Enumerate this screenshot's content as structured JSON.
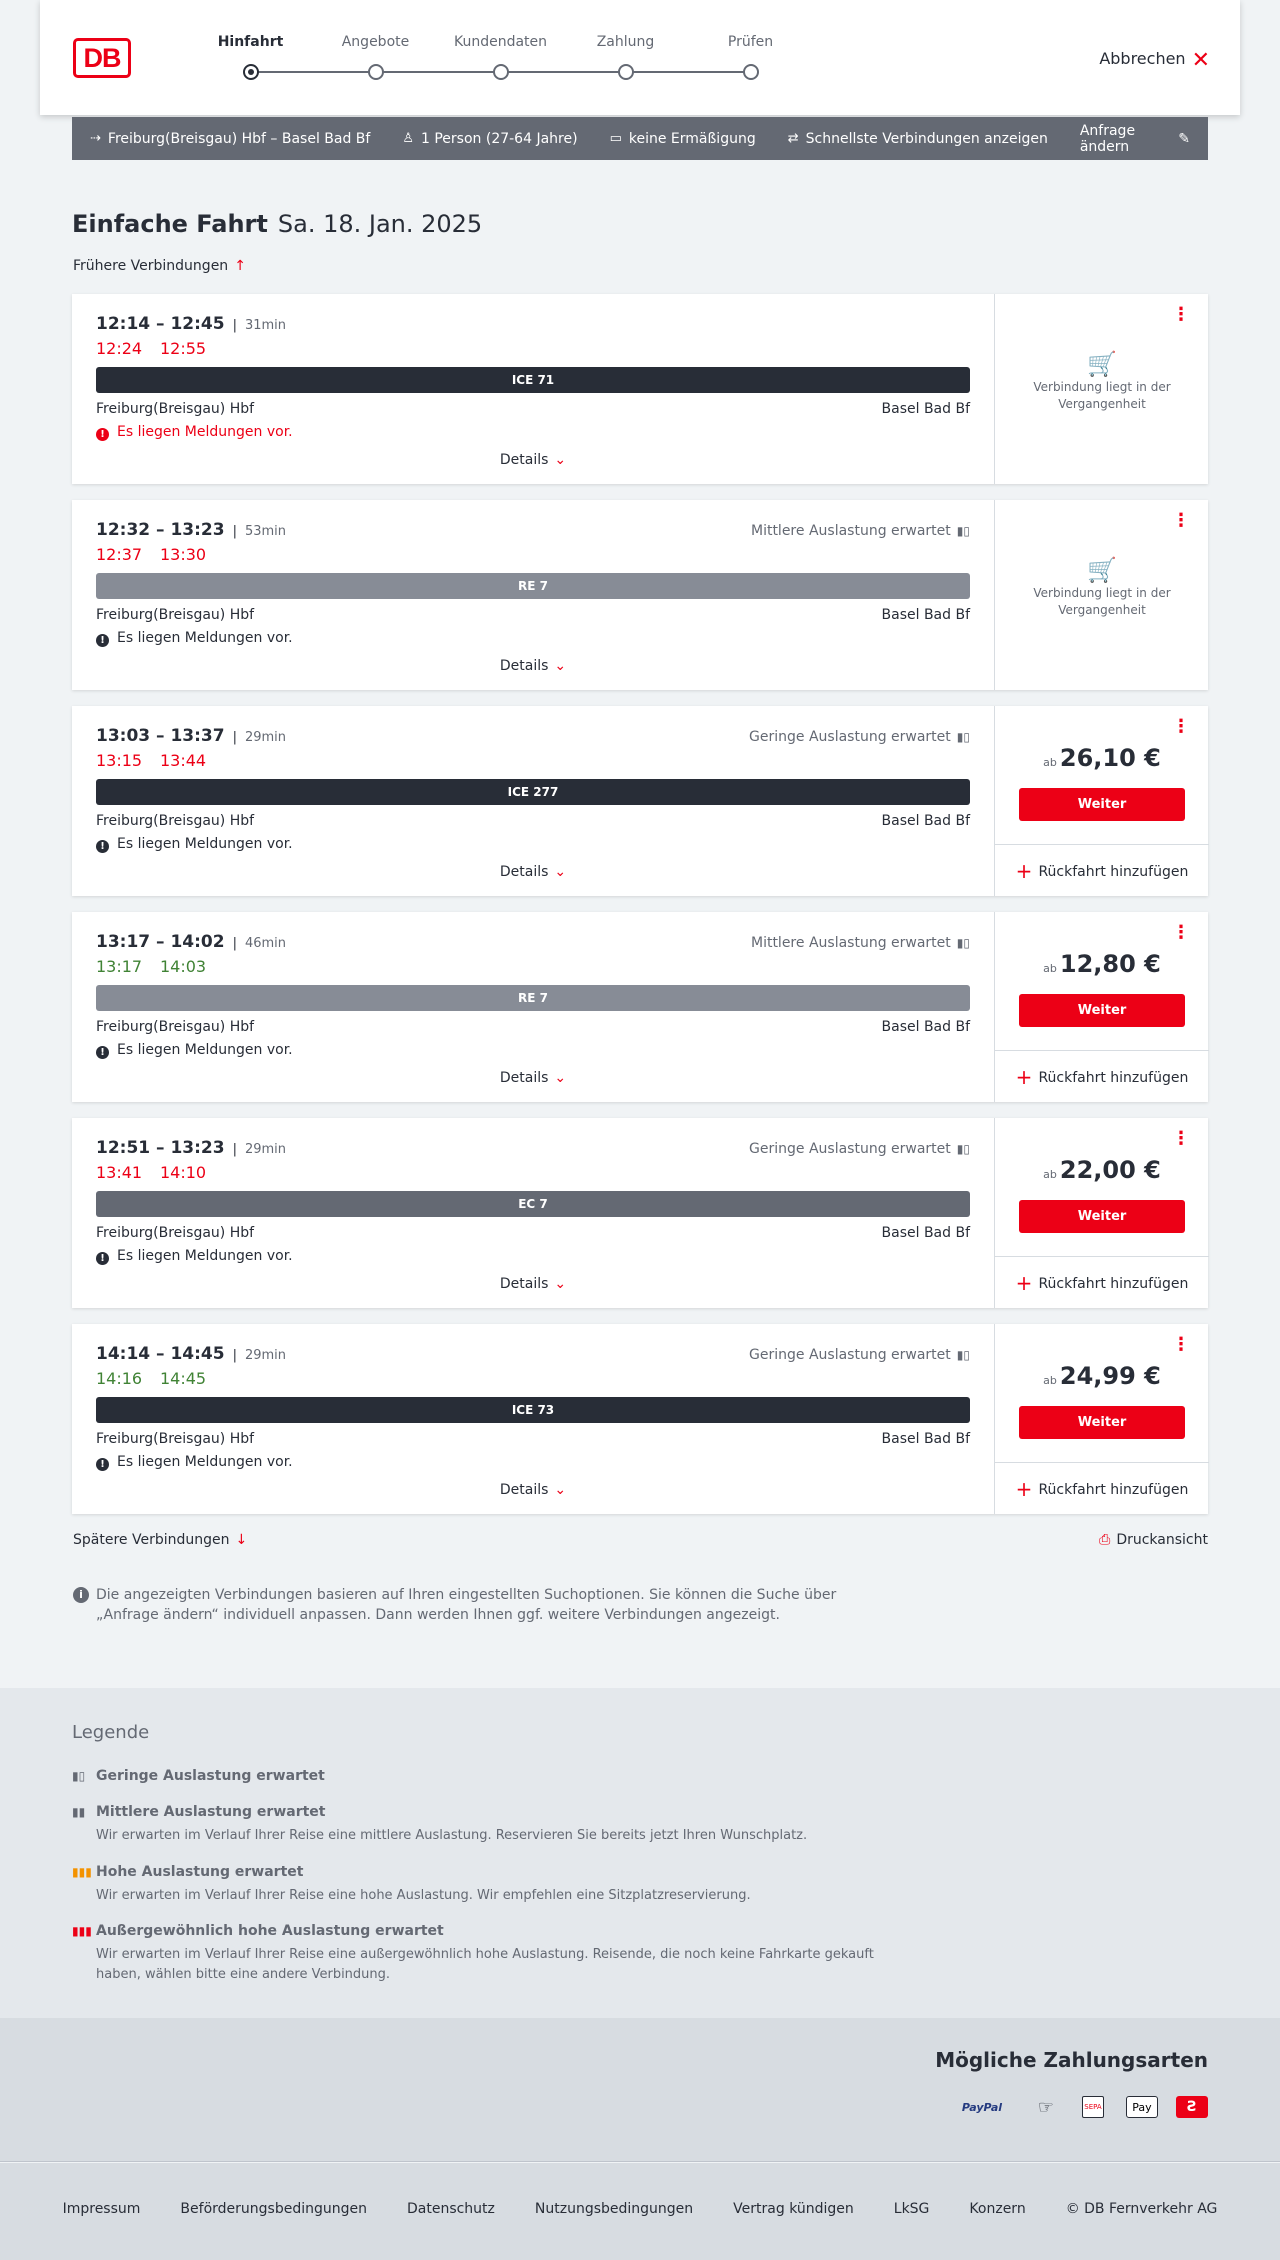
{
  "brand": {
    "logo": "DB",
    "accent": "#ec0016"
  },
  "stepper": {
    "steps": [
      {
        "label": "Hinfahrt",
        "active": true
      },
      {
        "label": "Angebote"
      },
      {
        "label": "Kundendaten"
      },
      {
        "label": "Zahlung"
      },
      {
        "label": "Prüfen"
      }
    ]
  },
  "header": {
    "cancel_label": "Abbrechen"
  },
  "search_bar": {
    "route": "Freiburg(Breisgau) Hbf – Basel Bad Bf",
    "travellers": "1 Person (27-64 Jahre)",
    "discount": "keine Ermäßigung",
    "fastest": "Schnellste Verbindungen anzeigen",
    "change": "Anfrage ändern"
  },
  "page": {
    "title_type": "Einfache Fahrt",
    "title_date": "Sa. 18. Jan. 2025",
    "earlier": "Frühere Verbindungen",
    "later": "Spätere Verbindungen",
    "print": "Druckansicht",
    "info_text": "Die angezeigten Verbindungen basieren auf Ihren eingestellten Suchoptionen. Sie können die Suche über „Anfrage ändern“ individuell anpassen. Dann werden Ihnen ggf. weitere Verbindungen angezeigt."
  },
  "connections": [
    {
      "planned": "12:14 – 12:45",
      "duration": "31min",
      "occupancy": "",
      "rt_dep": "12:24",
      "rt_arr": "12:55",
      "rt_status": "late",
      "train": "ICE 71",
      "train_type": "ice",
      "from": "Freiburg(Breisgau) Hbf",
      "to": "Basel Bad Bf",
      "message": "Es liegen Meldungen vor.",
      "message_red": true,
      "details": "Details",
      "past_text": "Verbindung liegt in der Vergangenheit",
      "price_prefix": "",
      "price": "",
      "button": "",
      "return": ""
    },
    {
      "planned": "12:32 – 13:23",
      "duration": "53min",
      "occupancy": "Mittlere Auslastung erwartet",
      "rt_dep": "12:37",
      "rt_arr": "13:30",
      "rt_status": "late",
      "train": "RE 7",
      "train_type": "re",
      "from": "Freiburg(Breisgau) Hbf",
      "to": "Basel Bad Bf",
      "message": "Es liegen Meldungen vor.",
      "message_red": false,
      "details": "Details",
      "past_text": "Verbindung liegt in der Vergangenheit",
      "price_prefix": "",
      "price": "",
      "button": "",
      "return": ""
    },
    {
      "planned": "13:03 – 13:37",
      "duration": "29min",
      "occupancy": "Geringe Auslastung erwartet",
      "rt_dep": "13:15",
      "rt_arr": "13:44",
      "rt_status": "late",
      "train": "ICE 277",
      "train_type": "ice",
      "from": "Freiburg(Breisgau) Hbf",
      "to": "Basel Bad Bf",
      "message": "Es liegen Meldungen vor.",
      "message_red": false,
      "details": "Details",
      "past_text": "",
      "price_prefix": "ab",
      "price": "26,10 €",
      "button": "Weiter",
      "return": "Rückfahrt hinzufügen"
    },
    {
      "planned": "13:17 – 14:02",
      "duration": "46min",
      "occupancy": "Mittlere Auslastung erwartet",
      "rt_dep": "13:17",
      "rt_arr": "14:03",
      "rt_status": "ontime",
      "train": "RE 7",
      "train_type": "re",
      "from": "Freiburg(Breisgau) Hbf",
      "to": "Basel Bad Bf",
      "message": "Es liegen Meldungen vor.",
      "message_red": false,
      "details": "Details",
      "past_text": "",
      "price_prefix": "ab",
      "price": "12,80 €",
      "button": "Weiter",
      "return": "Rückfahrt hinzufügen"
    },
    {
      "planned": "12:51 – 13:23",
      "duration": "29min",
      "occupancy": "Geringe Auslastung erwartet",
      "rt_dep": "13:41",
      "rt_arr": "14:10",
      "rt_status": "late",
      "train": "EC 7",
      "train_type": "ec",
      "from": "Freiburg(Breisgau) Hbf",
      "to": "Basel Bad Bf",
      "message": "Es liegen Meldungen vor.",
      "message_red": false,
      "details": "Details",
      "past_text": "",
      "price_prefix": "ab",
      "price": "22,00 €",
      "button": "Weiter",
      "return": "Rückfahrt hinzufügen"
    },
    {
      "planned": "14:14 – 14:45",
      "duration": "29min",
      "occupancy": "Geringe Auslastung erwartet",
      "rt_dep": "14:16",
      "rt_arr": "14:45",
      "rt_status": "ontime",
      "train": "ICE 73",
      "train_type": "ice",
      "from": "Freiburg(Breisgau) Hbf",
      "to": "Basel Bad Bf",
      "message": "Es liegen Meldungen vor.",
      "message_red": false,
      "details": "Details",
      "past_text": "",
      "price_prefix": "ab",
      "price": "24,99 €",
      "button": "Weiter",
      "return": "Rückfahrt hinzufügen"
    }
  ],
  "legend": {
    "title": "Legende",
    "items": [
      {
        "title": "Geringe Auslastung erwartet",
        "desc": "",
        "color": "#646973"
      },
      {
        "title": "Mittlere Auslastung erwartet",
        "desc": "Wir erwarten im Verlauf Ihrer Reise eine mittlere Auslastung. Reservieren Sie bereits jetzt Ihren Wunschplatz.",
        "color": "#646973"
      },
      {
        "title": "Hohe Auslastung erwartet",
        "desc": "Wir erwarten im Verlauf Ihrer Reise eine hohe Auslastung. Wir empfehlen eine Sitzplatzreservierung.",
        "color": "#f39200"
      },
      {
        "title": "Außergewöhnlich hohe Auslastung erwartet",
        "desc": "Wir erwarten im Verlauf Ihrer Reise eine außergewöhnlich hohe Auslastung. Reisende, die noch keine Fahrkarte gekauft haben, wählen bitte eine andere Verbindung.",
        "color": "#ec0016"
      }
    ]
  },
  "payment": {
    "title": "Mögliche Zahlungsarten",
    "methods": [
      {
        "label": "PayPal",
        "icon": "paypal-icon"
      },
      {
        "label": "",
        "icon": "credit-card-icon"
      },
      {
        "label": "SEPA",
        "icon": "sepa-icon"
      },
      {
        "label": "Pay",
        "icon": "apple-pay-icon"
      },
      {
        "label": "",
        "icon": "db-bonus-icon"
      }
    ]
  },
  "footer": {
    "links": [
      "Impressum",
      "Beförderungsbedingungen",
      "Datenschutz",
      "Nutzungsbedingungen",
      "Vertrag kündigen",
      "LkSG",
      "Konzern",
      "© DB Fernverkehr AG"
    ]
  }
}
